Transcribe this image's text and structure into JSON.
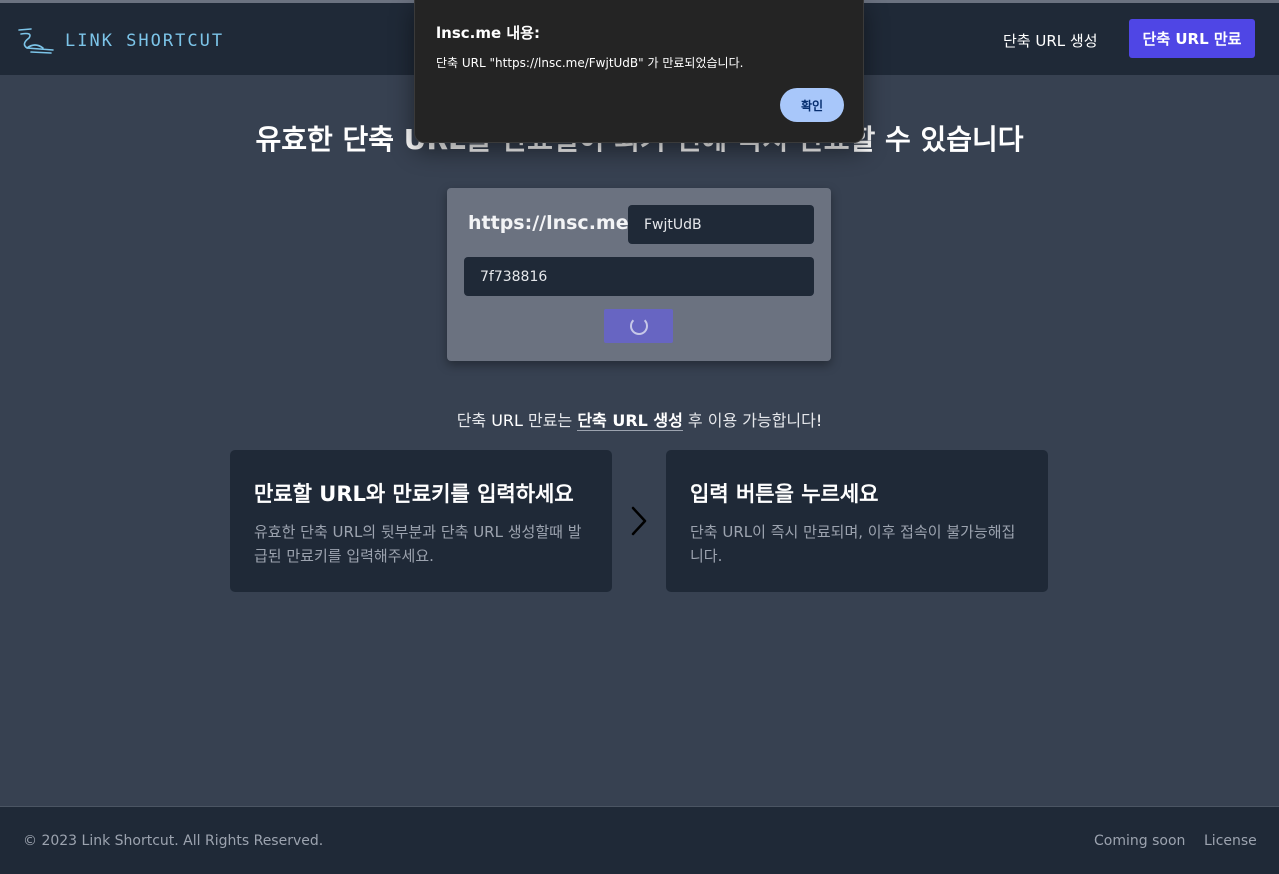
{
  "header": {
    "logo_text": "LINK SHORTCUT",
    "nav_create": "단축 URL 생성",
    "nav_expire": "단축 URL 만료"
  },
  "main": {
    "headline": "유효한 단축 URL을 만료일이 되기 전에 즉시 만료할 수 있습니다",
    "url_prefix": "https://lnsc.me/",
    "short_code_value": "FwjtUdB",
    "expire_key_value": "7f738816",
    "notice_part1": "단축 ",
    "notice_url": "URL",
    "notice_part2": " 만료는 ",
    "notice_link": "단축 URL 생성",
    "notice_part3": " 후 이용 가능합니다",
    "notice_bang": "!"
  },
  "steps": [
    {
      "title": "만료할 URL와 만료키를 입력하세요",
      "description": "유효한 단축 URL의 뒷부분과 단축 URL 생성할때 발급된 만료키를 입력해주세요."
    },
    {
      "title": "입력 버튼을 누르세요",
      "description": "단축 URL이 즉시 만료되며, 이후 접속이 불가능해집니다."
    }
  ],
  "footer": {
    "copyright": "© 2023 Link Shortcut. All Rights Reserved.",
    "coming_soon": "Coming soon",
    "license": "License"
  },
  "dialog": {
    "title": "lnsc.me 내용:",
    "message": "단축 URL \"https://lnsc.me/FwjtUdB\" 가 만료되었습니다.",
    "confirm": "확인"
  },
  "colors": {
    "background": "#374151",
    "header": "#1f2937",
    "accent": "#4f46e5",
    "card": "#6b7280",
    "dialog_button": "#a8c7fa"
  },
  "icons": {
    "logo": "link-logo-icon",
    "arrow": "chevron-right-icon",
    "spinner": "loading-spinner-icon"
  }
}
